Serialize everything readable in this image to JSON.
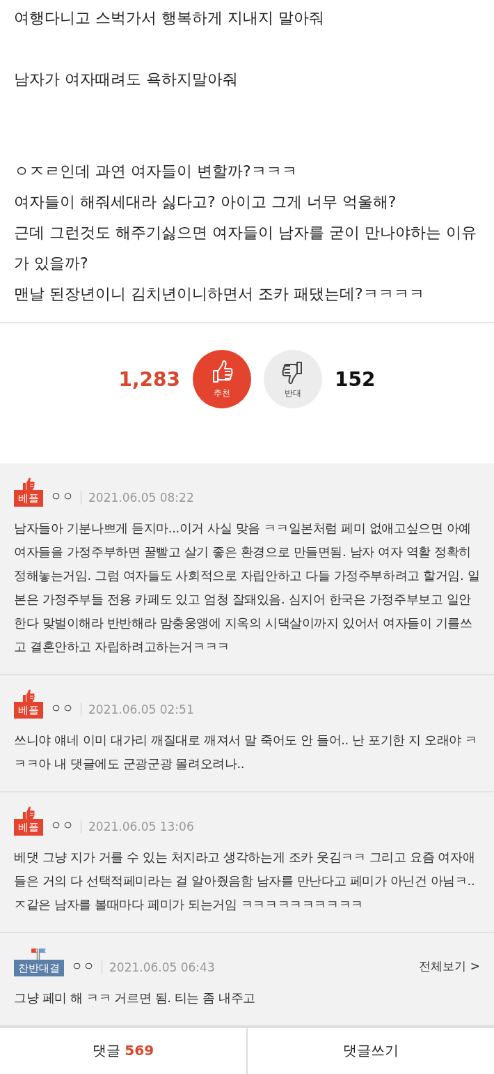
{
  "article": {
    "paragraphs": [
      {
        "text": "여행다니고 스벅가서 행복하게 지내지 말아줘"
      },
      {
        "text": "남자가 여자때려도 욕하지말아줘"
      },
      {
        "text": "ㅇㅈㄹ인데 과연 여자들이 변할까?ㅋㅋㅋ"
      },
      {
        "text": "여자들이 해줘세대라 싫다고? 아이고 그게 너무 억울해?"
      },
      {
        "text": "근데 그런것도 해주기싫으면 여자들이 남자를 굳이 만나야하는 이유가 있을까?"
      },
      {
        "text": "맨날 된장년이니 김치년이니하면서 조카 패댔는데?ㅋㅋㅋㅋ"
      }
    ]
  },
  "votes": {
    "up": {
      "count": "1,283",
      "label": "추천",
      "selected": true
    },
    "down": {
      "count": "152",
      "label": "반대",
      "selected": false
    }
  },
  "comments": [
    {
      "badge": {
        "kind": "best",
        "label": "베플"
      },
      "author": "ㅇㅇ",
      "time": "2021.06.05 08:22",
      "text": "남자들아 기분나쁘게 듣지마...이거 사실 맞음 ㅋㅋ일본처럼 페미 없애고싶으면 아예 여자들을 가정주부하면 꿀빨고 살기 좋은 환경으로 만들면됨. 남자 여자 역활 정확히 정해놓는거임. 그럼 여자들도 사회적으로 자립안하고 다들 가정주부하려고 할거임. 일본은 가정주부들 전용 카페도 있고 엄청 잘돼있음. 심지어 한국은 가정주부보고 일안한다 맞벌이해라 반반해라 맘충웅앵에 지옥의 시댁살이까지 있어서 여자들이 기를쓰고 결혼안하고 자립하려고하는거ㅋㅋㅋ"
    },
    {
      "badge": {
        "kind": "best",
        "label": "베플"
      },
      "author": "ㅇㅇ",
      "time": "2021.06.05 02:51",
      "text": "쓰니야 얘네 이미 대가리 깨질대로 깨져서 말 죽어도 안 들어.. 난 포기한 지 오래야 ㅋㅋㅋ아 내 댓글에도 군광군광 몰려오려나.."
    },
    {
      "badge": {
        "kind": "best",
        "label": "베플"
      },
      "author": "ㅇㅇ",
      "time": "2021.06.05 13:06",
      "text": "베댓 그냥 지가 거를 수 있는 처지라고 생각하는게 조카 웃김ㅋㅋ 그리고 요즘 여자애들은 거의 다 선택적페미라는 걸 알아줬음함 남자를 만난다고 페미가 아닌건 아님ㅋ.. ㅈ같은 남자를 볼때마다 페미가 되는거임 ㅋㅋㅋㅋㅋㅋㅋㅋㅋㅋ"
    },
    {
      "badge": {
        "kind": "battle",
        "label": "찬반대결"
      },
      "author": "ㅇㅇ",
      "time": "2021.06.05 06:43",
      "more": "전체보기 >",
      "text": "그냥 페미 해 ㅋㅋ 거르면 됨. 티는 좀 내주고"
    }
  ],
  "footer": {
    "comments_label": "댓글",
    "comments_count": "569",
    "write_label": "댓글쓰기"
  }
}
